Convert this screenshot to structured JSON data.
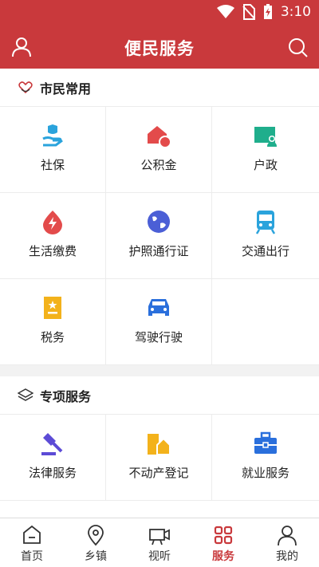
{
  "status": {
    "time": "3:10"
  },
  "header": {
    "title": "便民服务",
    "profile_icon": "person-icon",
    "search_icon": "search-icon"
  },
  "sections": [
    {
      "title": "市民常用",
      "icon": "heart-hands-icon",
      "items": [
        {
          "label": "社保",
          "icon": "social-security-icon",
          "color": "#2aa3dc"
        },
        {
          "label": "公积金",
          "icon": "housing-fund-icon",
          "color": "#e34b4b"
        },
        {
          "label": "户政",
          "icon": "household-icon",
          "color": "#1fae8c"
        },
        {
          "label": "生活缴费",
          "icon": "utility-payment-icon",
          "color": "#e34b4b"
        },
        {
          "label": "护照通行证",
          "icon": "passport-icon",
          "color": "#4b5fd6"
        },
        {
          "label": "交通出行",
          "icon": "transport-icon",
          "color": "#2aa3dc"
        },
        {
          "label": "税务",
          "icon": "tax-icon",
          "color": "#f3b21b"
        },
        {
          "label": "驾驶行驶",
          "icon": "car-icon",
          "color": "#2a6fdc"
        }
      ]
    },
    {
      "title": "专项服务",
      "icon": "layers-icon",
      "items": [
        {
          "label": "法律服务",
          "icon": "gavel-icon",
          "color": "#5c4bd6"
        },
        {
          "label": "不动产登记",
          "icon": "real-estate-icon",
          "color": "#f3b21b"
        },
        {
          "label": "就业服务",
          "icon": "briefcase-icon",
          "color": "#2a6fdc"
        }
      ]
    }
  ],
  "tabs": [
    {
      "label": "首页",
      "icon": "home-icon"
    },
    {
      "label": "乡镇",
      "icon": "location-pin-icon"
    },
    {
      "label": "视听",
      "icon": "video-camera-icon"
    },
    {
      "label": "服务",
      "icon": "grid-icon",
      "active": true
    },
    {
      "label": "我的",
      "icon": "person-icon"
    }
  ],
  "colors": {
    "brand": "#c9393c"
  }
}
